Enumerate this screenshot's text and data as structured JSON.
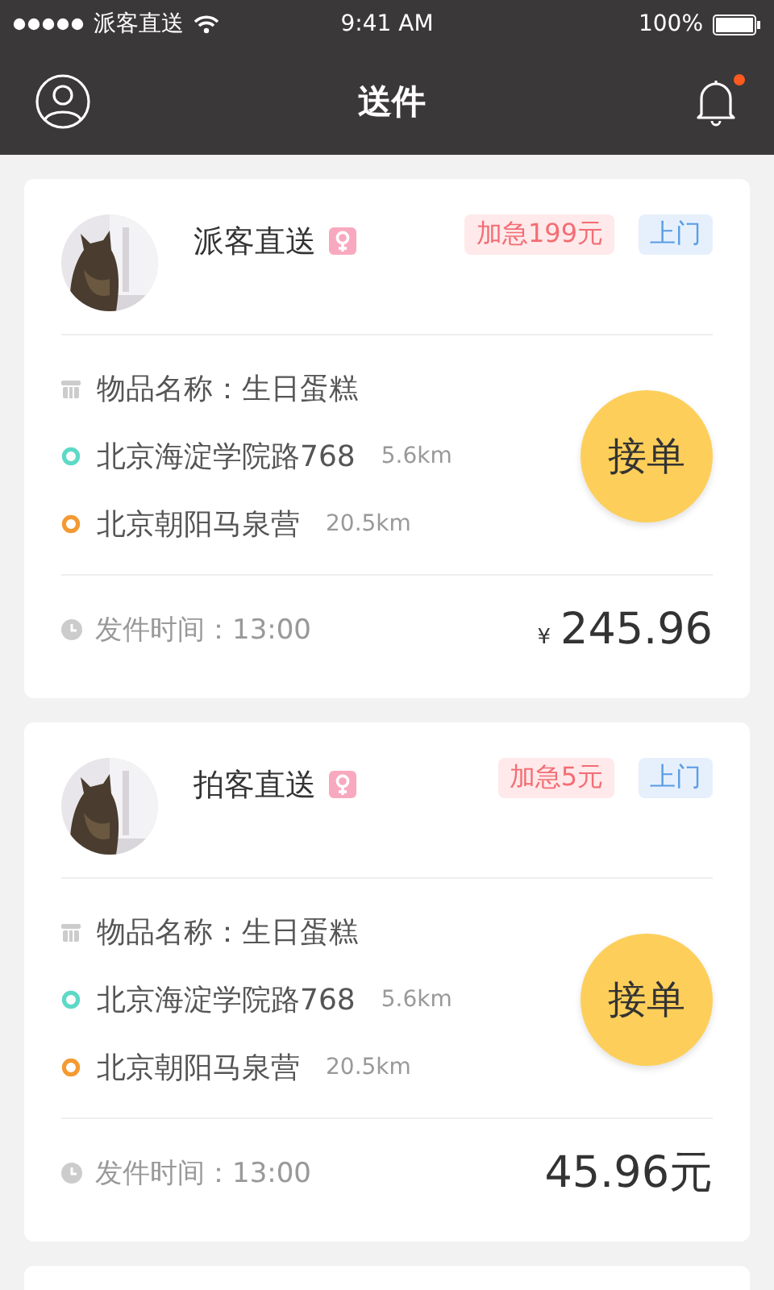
{
  "status_bar": {
    "carrier": "派客直送",
    "time": "9:41 AM",
    "battery": "100%"
  },
  "nav": {
    "title": "送件",
    "notification_dot": true
  },
  "orders": [
    {
      "name": "派客直送",
      "tags": [
        {
          "kind": "urgent",
          "text": "加急199元"
        },
        {
          "kind": "pickup",
          "text": "上门"
        }
      ],
      "item": "物品名称：生日蛋糕",
      "from": {
        "address": "北京海淀学院路768",
        "distance": "5.6km"
      },
      "to": {
        "address": "北京朝阳马泉营",
        "distance": "20.5km"
      },
      "accept": "接单",
      "time": "发件时间：13:00",
      "price": {
        "prefix": "¥",
        "amount": "245.96"
      }
    },
    {
      "name": "拍客直送",
      "tags": [
        {
          "kind": "urgent",
          "text": "加急5元"
        },
        {
          "kind": "pickup",
          "text": "上门"
        }
      ],
      "item": "物品名称：生日蛋糕",
      "from": {
        "address": "北京海淀学院路768",
        "distance": "5.6km"
      },
      "to": {
        "address": "北京朝阳马泉营",
        "distance": "20.5km"
      },
      "accept": "接单",
      "time": "发件时间：13:00",
      "price": {
        "amount": "45.96",
        "suffix": "元"
      }
    }
  ]
}
